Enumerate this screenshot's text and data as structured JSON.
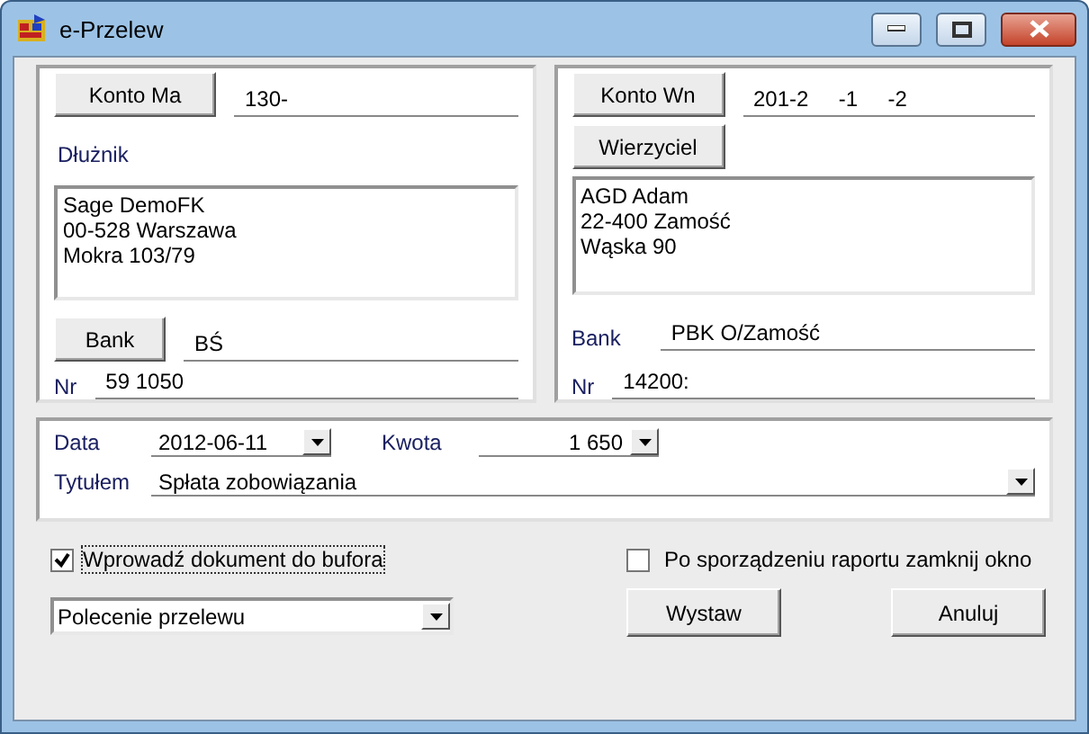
{
  "window": {
    "title": "e-Przelew"
  },
  "left": {
    "account_button": "Konto Ma",
    "account": "130-",
    "party_label": "Dłużnik",
    "address": [
      "Sage DemoFK",
      "00-528 Warszawa",
      "Mokra 103/79"
    ],
    "bank_button": "Bank",
    "bank": "BŚ",
    "nr_label": "Nr",
    "nr": "59 1050"
  },
  "right": {
    "account_button": "Konto Wn",
    "account": "201-2     -1     -2",
    "party_button": "Wierzyciel",
    "address": [
      "AGD Adam",
      "22-400 Zamość",
      "Wąska 90"
    ],
    "bank_label": "Bank",
    "bank": "PBK O/Zamość",
    "nr_label": "Nr",
    "nr": "14200:"
  },
  "details": {
    "date_label": "Data",
    "date": "2012-06-11",
    "amount_label": "Kwota",
    "amount": "1 650",
    "title_label": "Tytułem",
    "title": "Spłata zobowiązania"
  },
  "buffer_checkbox": {
    "label": "Wprowadź dokument do bufora",
    "checked": true
  },
  "close_checkbox": {
    "label": "Po sporządzeniu raportu zamknij okno",
    "checked": false
  },
  "document_type": "Polecenie przelewu",
  "buttons": [
    "Wystaw",
    "Anuluj"
  ]
}
